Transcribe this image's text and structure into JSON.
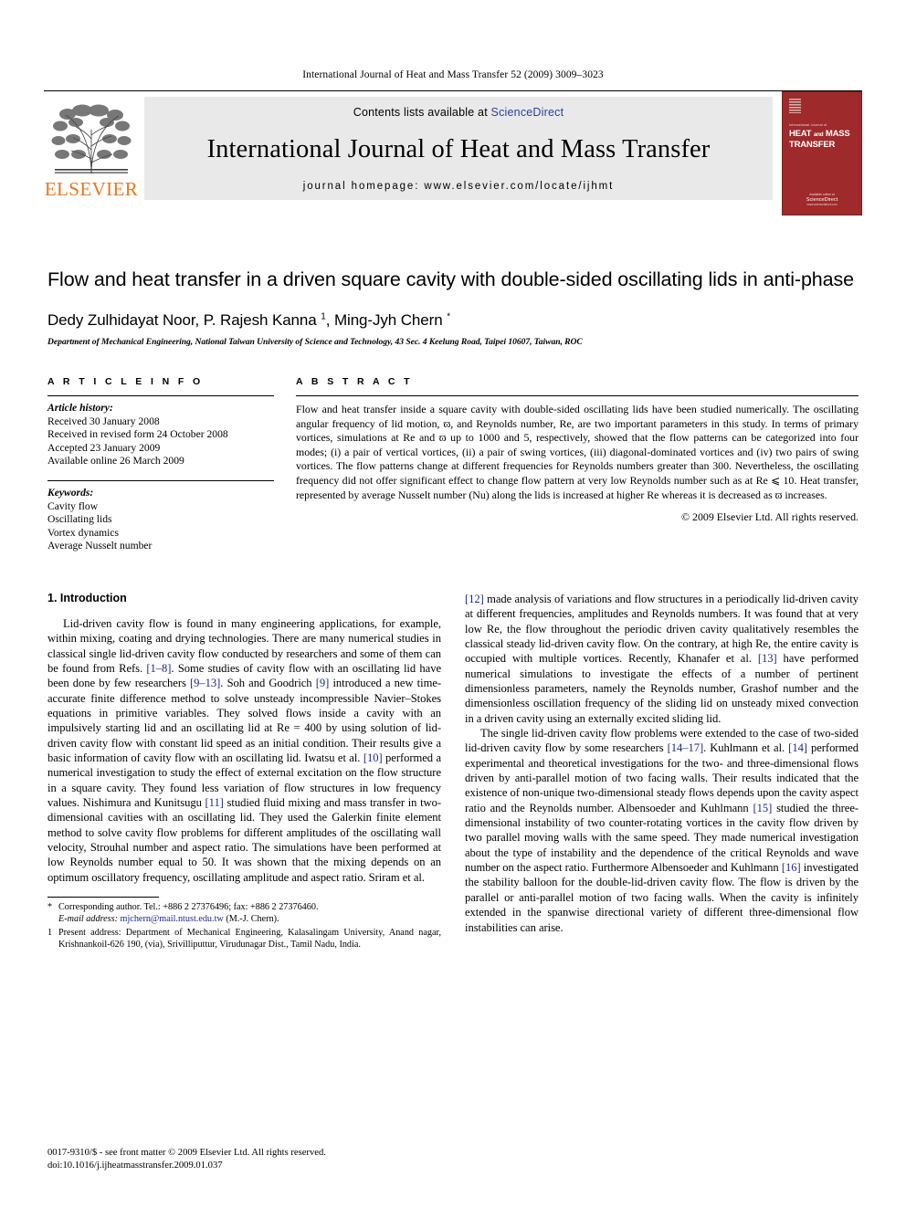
{
  "running_head": "International Journal of Heat and Mass Transfer 52 (2009) 3009–3023",
  "masthead": {
    "contents_prefix": "Contents lists available at ",
    "sciencedirect": "ScienceDirect",
    "journal_name": "International Journal of Heat and Mass Transfer",
    "homepage": "journal homepage: www.elsevier.com/locate/ijhmt",
    "publisher_logo_text": "ELSEVIER",
    "publisher_accent_color": "#E87722",
    "link_color": "#2c3e9e",
    "cover": {
      "kicker": "International Journal of",
      "title_line1": "HEAT",
      "title_and": "and",
      "title_line1b": "MASS",
      "title_line2": "TRANSFER",
      "foot_small": "Available online at",
      "foot_brand": "ScienceDirect",
      "foot_url": "www.sciencedirect.com",
      "background_color": "#9e2a2b"
    }
  },
  "article": {
    "title": "Flow and heat transfer in a driven square cavity with double-sided oscillating lids in anti-phase",
    "authors_pre": "Dedy Zulhidayat Noor, P. Rajesh Kanna ",
    "author_sup1": "1",
    "authors_mid": ", Ming-Jyh Chern ",
    "author_sup2": "*",
    "affiliation": "Department of Mechanical Engineering, National Taiwan University of Science and Technology, 43 Sec. 4 Keelung Road, Taipei 10607, Taiwan, ROC"
  },
  "article_info": {
    "heading": "A R T I C L E   I N F O",
    "history_label": "Article history:",
    "history": [
      "Received 30 January 2008",
      "Received in revised form 24 October 2008",
      "Accepted 23 January 2009",
      "Available online 26 March 2009"
    ],
    "keywords_label": "Keywords:",
    "keywords": [
      "Cavity flow",
      "Oscillating lids",
      "Vortex dynamics",
      "Average Nusselt number"
    ]
  },
  "abstract": {
    "heading": "A B S T R A C T",
    "text": "Flow and heat transfer inside a square cavity with double-sided oscillating lids have been studied numerically. The oscillating angular frequency of lid motion, ϖ, and Reynolds number, Re, are two important parameters in this study. In terms of primary vortices, simulations at Re and ϖ up to 1000 and 5, respectively, showed that the flow patterns can be categorized into four modes; (i) a pair of vertical vortices, (ii) a pair of swing vortices, (iii) diagonal-dominated vortices and (iv) two pairs of swing vortices. The flow patterns change at different frequencies for Reynolds numbers greater than 300. Nevertheless, the oscillating frequency did not offer significant effect to change flow pattern at very low Reynolds number such as at Re ⩽ 10. Heat transfer, represented by average Nusselt number (Nu) along the lids is increased at higher Re whereas it is decreased as ϖ increases.",
    "copyright": "© 2009 Elsevier Ltd. All rights reserved."
  },
  "body": {
    "section_title": "1. Introduction",
    "left_paragraphs": [
      "Lid-driven cavity flow is found in many engineering applications, for example, within mixing, coating and drying technologies. There are many numerical studies in classical single lid-driven cavity flow conducted by researchers and some of them can be found from Refs. [1–8]. Some studies of cavity flow with an oscillating lid have been done by few researchers [9–13]. Soh and Goodrich [9] introduced a new time-accurate finite difference method to solve unsteady incompressible Navier–Stokes equations in primitive variables. They solved flows inside a cavity with an impulsively starting lid and an oscillating lid at Re = 400 by using solution of lid-driven cavity flow with constant lid speed as an initial condition. Their results give a basic information of cavity flow with an oscillating lid. Iwatsu et al. [10] performed a numerical investigation to study the effect of external excitation on the flow structure in a square cavity. They found less variation of flow structures in low frequency values. Nishimura and Kunitsugu [11] studied fluid mixing and mass transfer in two-dimensional cavities with an oscillating lid. They used the Galerkin finite element method to solve cavity flow problems for different amplitudes of the oscillating wall velocity, Strouhal number and aspect ratio. The simulations have been performed at low Reynolds number equal to 50. It was shown that the mixing depends on an optimum oscillatory frequency, oscillating amplitude and aspect ratio. Sriram et al."
    ],
    "right_paragraphs": [
      "[12] made analysis of variations and flow structures in a periodically lid-driven cavity at different frequencies, amplitudes and Reynolds numbers. It was found that at very low Re, the flow throughout the periodic driven cavity qualitatively resembles the classical steady lid-driven cavity flow. On the contrary, at high Re, the entire cavity is occupied with multiple vortices. Recently, Khanafer et al. [13] have performed numerical simulations to investigate the effects of a number of pertinent dimensionless parameters, namely the Reynolds number, Grashof number and the dimensionless oscillation frequency of the sliding lid on unsteady mixed convection in a driven cavity using an externally excited sliding lid.",
      "The single lid-driven cavity flow problems were extended to the case of two-sided lid-driven cavity flow by some researchers [14–17]. Kuhlmann et al. [14] performed experimental and theoretical investigations for the two- and three-dimensional flows driven by anti-parallel motion of two facing walls. Their results indicated that the existence of non-unique two-dimensional steady flows depends upon the cavity aspect ratio and the Reynolds number. Albensoeder and Kuhlmann [15] studied the three-dimensional instability of two counter-rotating vortices in the cavity flow driven by two parallel moving walls with the same speed. They made numerical investigation about the type of instability and the dependence of the critical Reynolds and wave number on the aspect ratio. Furthermore Albensoeder and Kuhlmann [16] investigated the stability balloon for the double-lid-driven cavity flow. The flow is driven by the parallel or anti-parallel motion of two facing walls. When the cavity is infinitely extended in the spanwise directional variety of different three-dimensional flow instabilities can arise."
    ]
  },
  "footnotes": {
    "corresponding_mark": "*",
    "corresponding_text": "Corresponding author. Tel.: +886 2 27376496; fax: +886 2 27376460.",
    "email_label": "E-mail address:",
    "email": "mjchern@mail.ntust.edu.tw",
    "email_suffix": "(M.-J. Chern).",
    "present_mark": "1",
    "present_text": "Present address: Department of Mechanical Engineering, Kalasalingam University, Anand nagar, Krishnankoil-626 190, (via), Srivilliputtur, Virudunagar Dist., Tamil Nadu, India."
  },
  "footer": {
    "issn_line": "0017-9310/$ - see front matter © 2009 Elsevier Ltd. All rights reserved.",
    "doi_line": "doi:10.1016/j.ijheatmasstransfer.2009.01.037"
  }
}
